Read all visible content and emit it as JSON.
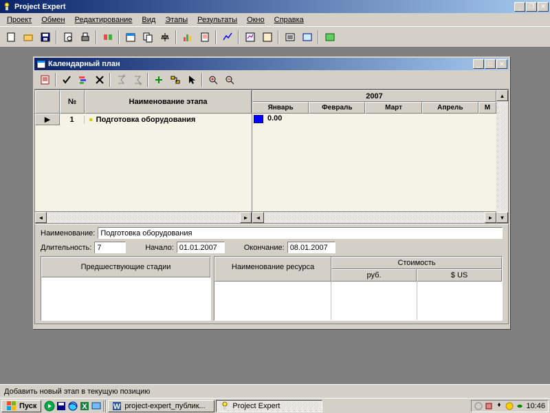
{
  "app": {
    "title": "Project Expert"
  },
  "menu": [
    "Проект",
    "Обмен",
    "Редактирование",
    "Вид",
    "Этапы",
    "Результаты",
    "Окно",
    "Справка"
  ],
  "child": {
    "title": "Календарный план",
    "grid": {
      "col_num": "№",
      "col_name": "Наименование этапа",
      "rows": [
        {
          "num": "1",
          "name": "Подготовка оборудования"
        }
      ]
    },
    "gantt": {
      "year": "2007",
      "months": [
        "Январь",
        "Февраль",
        "Март",
        "Апрель",
        "М"
      ],
      "value": "0.00"
    },
    "details": {
      "name_label": "Наименование:",
      "name_value": "Подготовка оборудования",
      "duration_label": "Длительность:",
      "duration_value": "7",
      "start_label": "Начало:",
      "start_value": "01.01.2007",
      "end_label": "Окончание:",
      "end_value": "08.01.2007",
      "pred_header": "Предшествующие стадии",
      "res_header": "Наименование ресурса",
      "cost_header": "Стоимость",
      "rub": "руб.",
      "usd": "$ US"
    }
  },
  "status": "Добавить новый этап в текущую позицию",
  "taskbar": {
    "start": "Пуск",
    "tasks": [
      {
        "label": "project-expert_публик...",
        "active": false
      },
      {
        "label": "Project Expert",
        "active": true
      }
    ],
    "time": "10:46"
  }
}
